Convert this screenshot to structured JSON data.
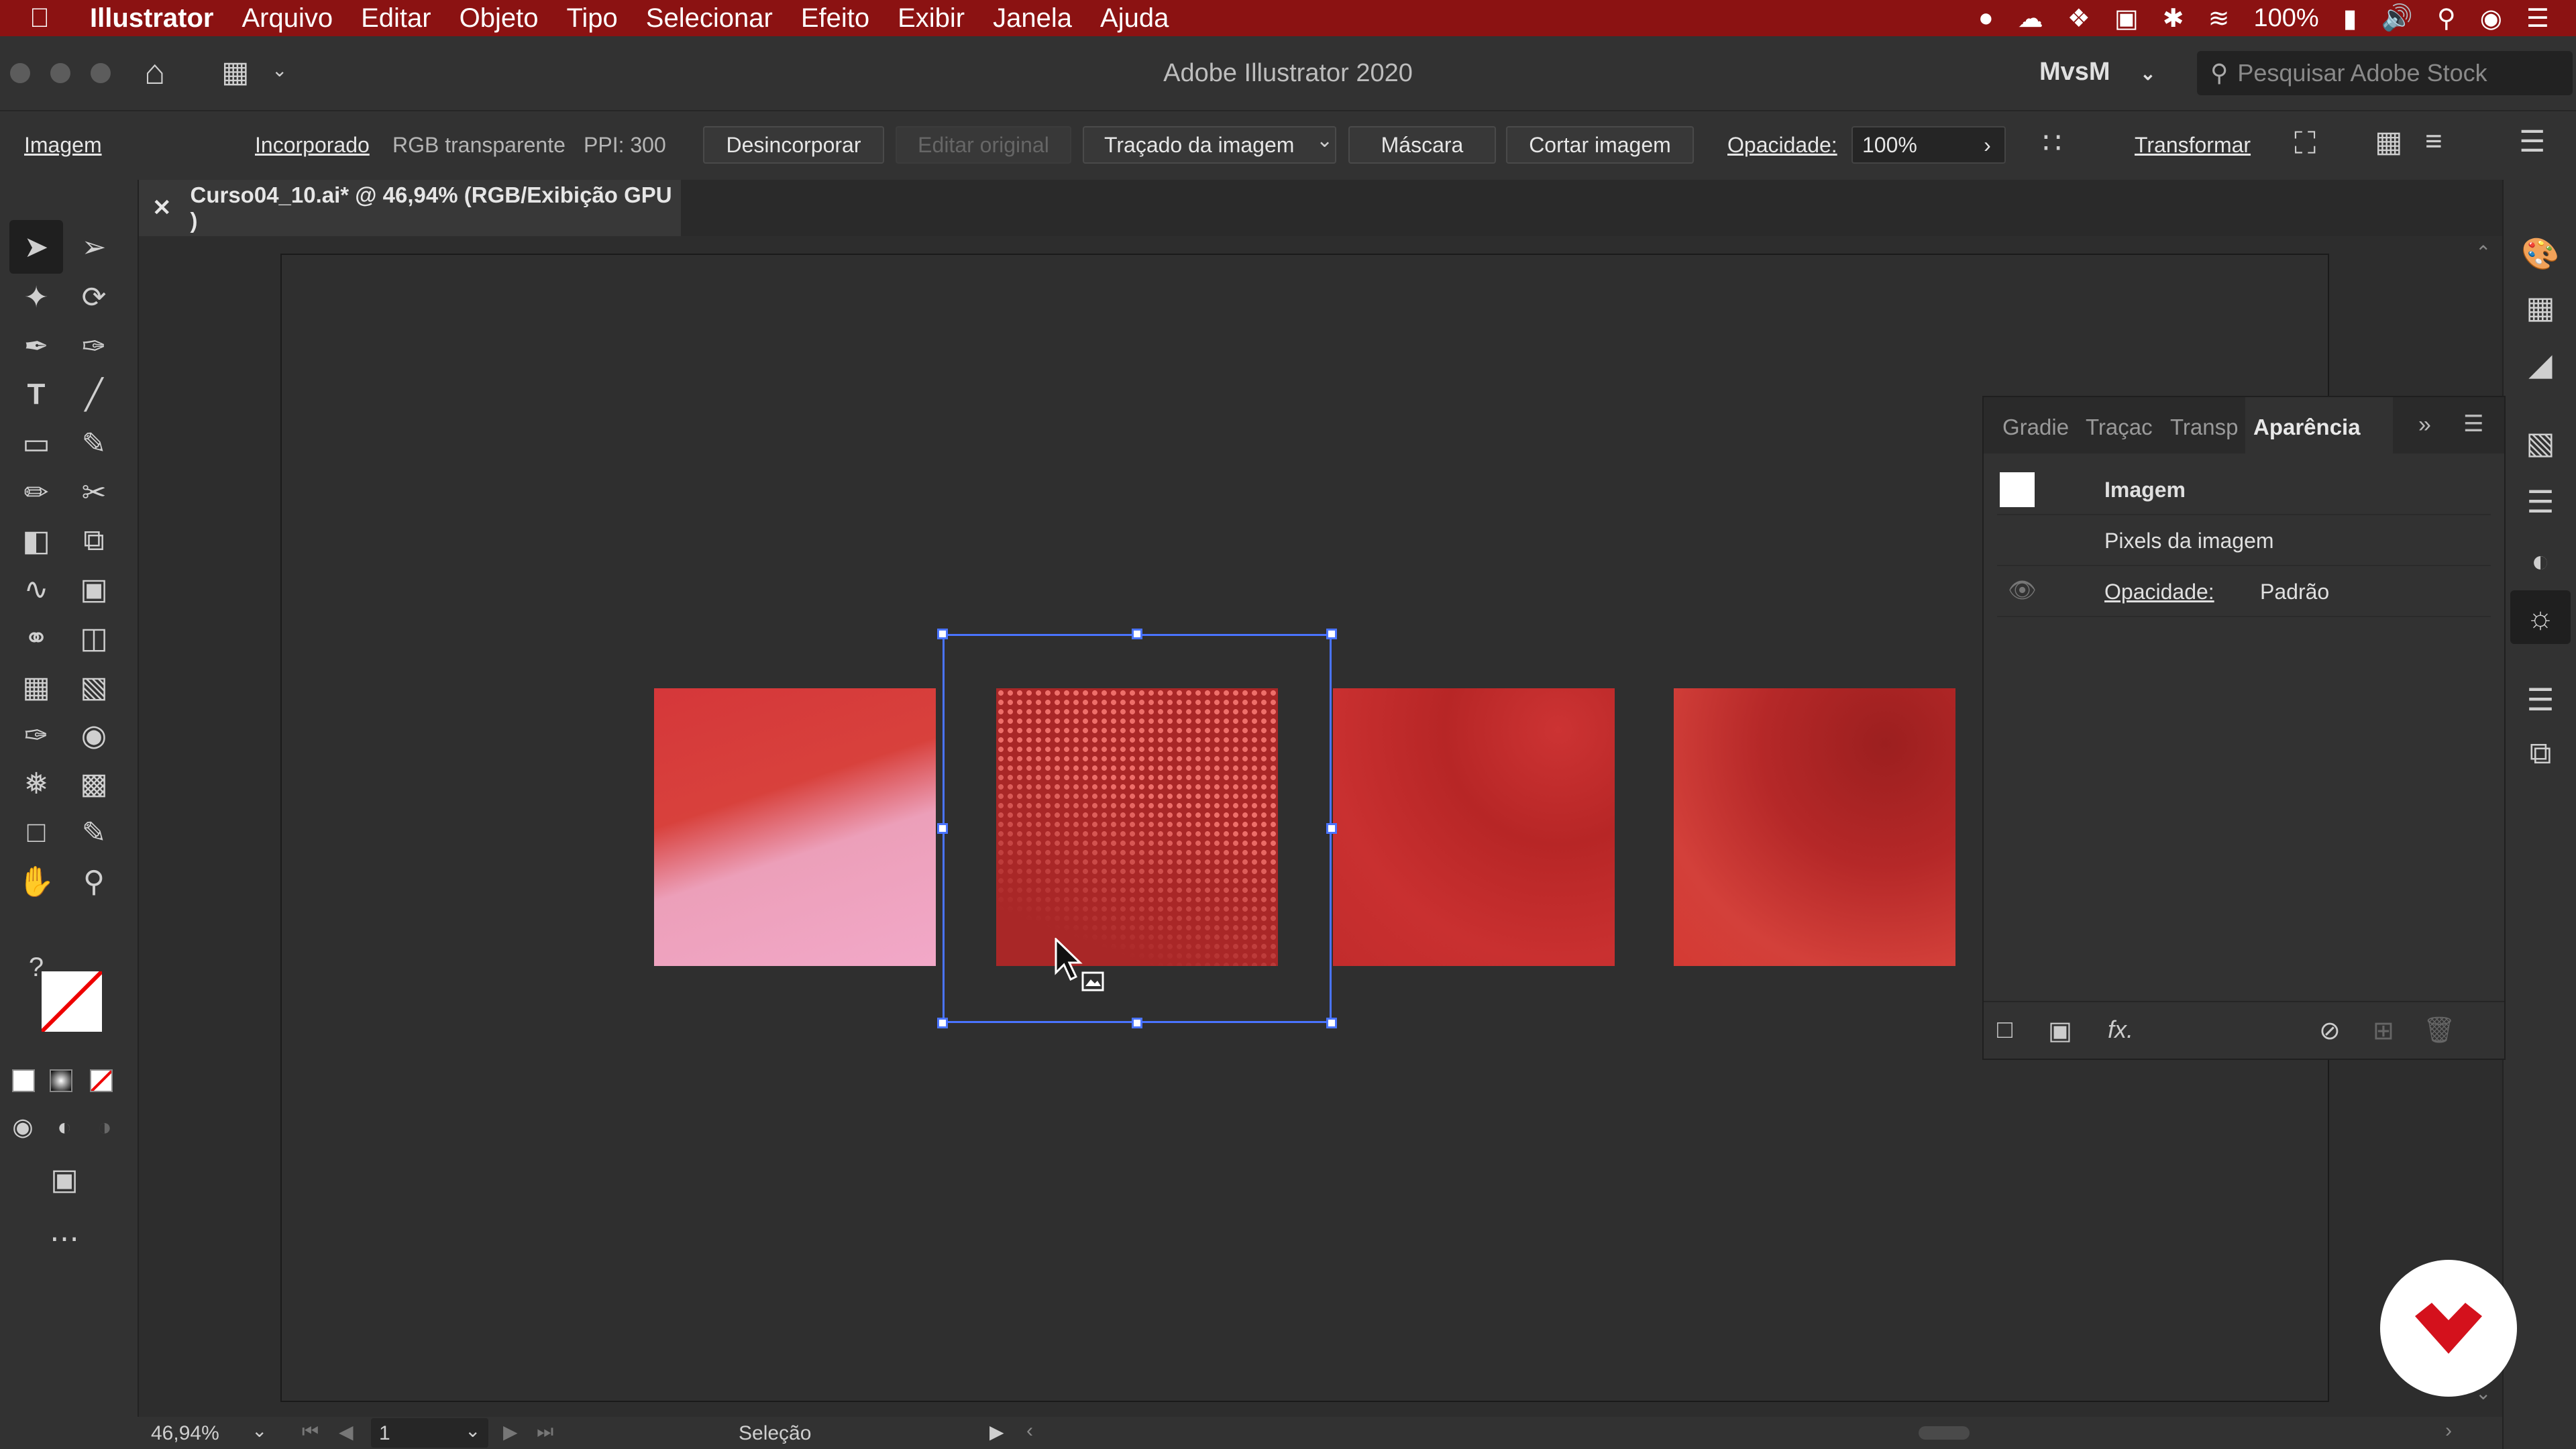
{
  "menubar": {
    "app_name": "Illustrator",
    "items": [
      "Arquivo",
      "Editar",
      "Objeto",
      "Tipo",
      "Selecionar",
      "Efeito",
      "Exibir",
      "Janela",
      "Ajuda"
    ],
    "battery": "100%"
  },
  "titlebar": {
    "title": "Adobe Illustrator 2020",
    "workspace": "MvsM",
    "search_placeholder": "Pesquisar Adobe Stock"
  },
  "controlbar": {
    "object_type": "Imagem",
    "embedded_link": "Incorporado",
    "color_info": "RGB transparente",
    "ppi": "PPI: 300",
    "unembed_label": "Desincorporar",
    "edit_original_label": "Editar original",
    "image_trace_label": "Traçado da imagem",
    "mask_label": "Máscara",
    "crop_label": "Cortar imagem",
    "opacity_label": "Opacidade:",
    "opacity_value": "100%",
    "transform_label": "Transformar"
  },
  "document": {
    "tab_title": "Curso04_10.ai* @ 46,94% (RGB/Exibição GPU )"
  },
  "appearance_panel": {
    "tabs": [
      "Gradie",
      "Traçac",
      "Transp",
      "Aparência"
    ],
    "active_tab": "Aparência",
    "object_name": "Imagem",
    "row_pixels": "Pixels da imagem",
    "opacity_label": "Opacidade:",
    "opacity_value": "Padrão"
  },
  "statusbar": {
    "zoom": "46,94%",
    "artboard_number": "1",
    "tool_name": "Seleção"
  },
  "colors": {
    "menubar_bg": "#8b1212",
    "selection_blue": "#4a74ff",
    "thumb_red": "#d43a33",
    "thumb_pink": "#f0a8c4"
  }
}
